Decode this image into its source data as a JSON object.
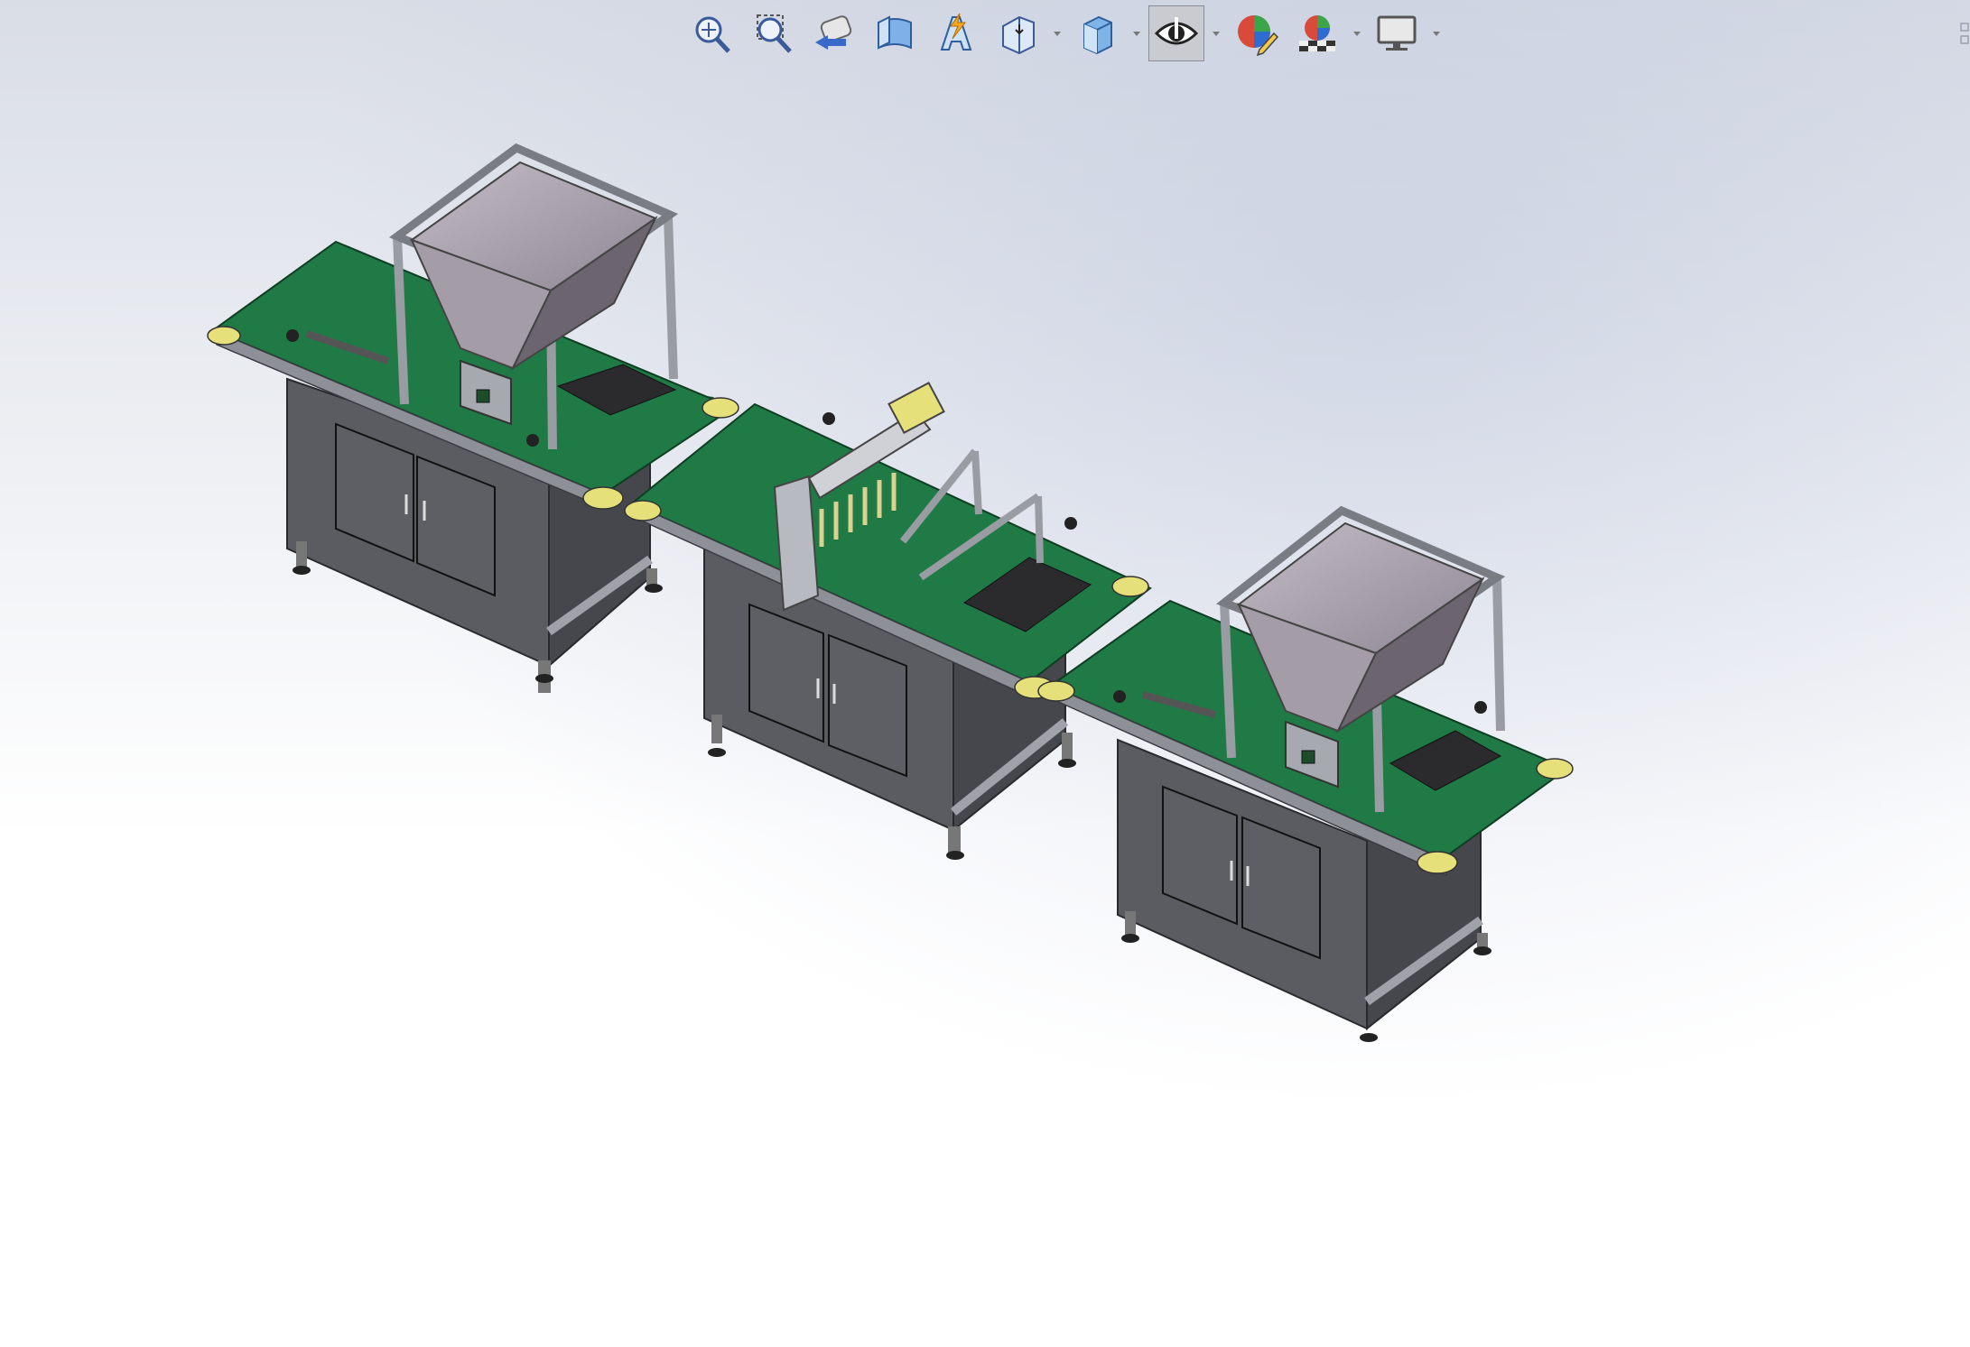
{
  "toolbar": {
    "buttons": [
      {
        "name": "zoom-to-fit",
        "icon": "zoom-to-fit-icon",
        "dropdown": false
      },
      {
        "name": "zoom-to-area",
        "icon": "zoom-to-area-icon",
        "dropdown": false
      },
      {
        "name": "previous-view",
        "icon": "previous-view-icon",
        "dropdown": false
      },
      {
        "name": "section-view",
        "icon": "section-view-icon",
        "dropdown": false
      },
      {
        "name": "dynamic-annotation-views",
        "icon": "dynamic-annotation-icon",
        "dropdown": false
      },
      {
        "name": "view-orientation",
        "icon": "view-orientation-icon",
        "dropdown": true
      },
      {
        "name": "display-style",
        "icon": "display-style-icon",
        "dropdown": true
      },
      {
        "name": "hide-show-items",
        "icon": "eye-icon",
        "dropdown": true,
        "active": true
      },
      {
        "name": "edit-appearance",
        "icon": "edit-appearance-icon",
        "dropdown": false
      },
      {
        "name": "apply-scene",
        "icon": "apply-scene-icon",
        "dropdown": true
      },
      {
        "name": "view-settings",
        "icon": "monitor-icon",
        "dropdown": true
      }
    ]
  },
  "colors": {
    "belt": "#1f7a45",
    "belt_dark": "#155c33",
    "frame": "#9a9ca4",
    "cabinet": "#5b5c62",
    "hopper": "#a49ca6",
    "roller_cap": "#e6e07a",
    "accent_active": "#c9cbd1"
  }
}
